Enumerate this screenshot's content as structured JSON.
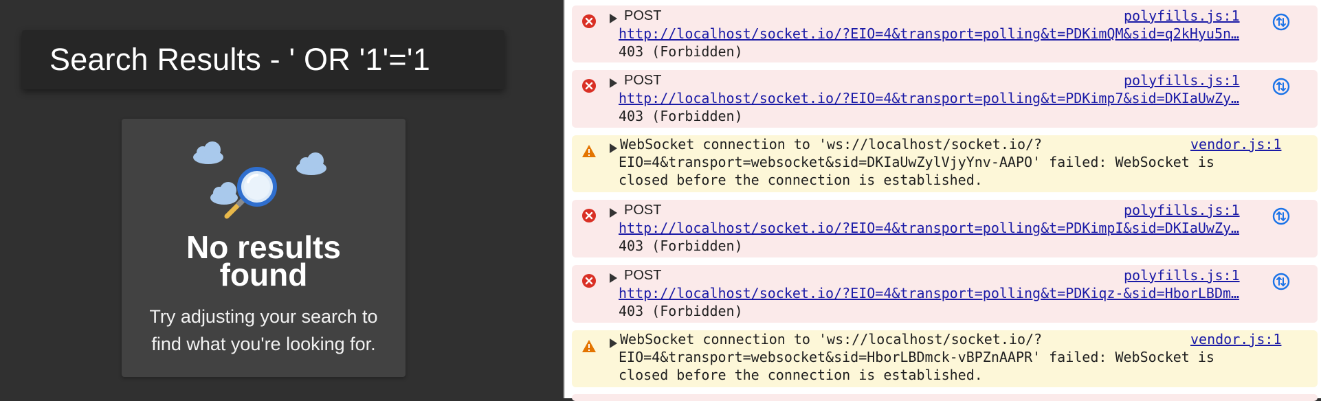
{
  "app": {
    "search_title": "Search Results - ' OR '1'='1",
    "empty_state": {
      "heading_line1": "No results",
      "heading_line2": "found",
      "hint_line1": "Try adjusting your search to",
      "hint_line2": "find what you're looking for."
    }
  },
  "console": {
    "entries": [
      {
        "level": "error",
        "method": "POST",
        "source": "polyfills.js:1",
        "url": "http://localhost/socket.io/?EIO=4&transport=polling&t=PDKimQM&sid=q2kHyu5n…",
        "status": "403 (Forbidden)"
      },
      {
        "level": "error",
        "method": "POST",
        "source": "polyfills.js:1",
        "url": "http://localhost/socket.io/?EIO=4&transport=polling&t=PDKimp7&sid=DKIaUwZy…",
        "status": "403 (Forbidden)"
      },
      {
        "level": "warning",
        "source": "vendor.js:1",
        "line1": "WebSocket connection to 'ws://localhost/socket.io/?",
        "line2": "EIO=4&transport=websocket&sid=DKIaUwZylVjyYnv-AAPO' failed: WebSocket is",
        "line3": "closed before the connection is established."
      },
      {
        "level": "error",
        "method": "POST",
        "source": "polyfills.js:1",
        "url": "http://localhost/socket.io/?EIO=4&transport=polling&t=PDKimpI&sid=DKIaUwZy…",
        "status": "403 (Forbidden)"
      },
      {
        "level": "error",
        "method": "POST",
        "source": "polyfills.js:1",
        "url": "http://localhost/socket.io/?EIO=4&transport=polling&t=PDKiqz-&sid=HborLBDm…",
        "status": "403 (Forbidden)"
      },
      {
        "level": "warning",
        "source": "vendor.js:1",
        "line1": "WebSocket connection to 'ws://localhost/socket.io/?",
        "line2": "EIO=4&transport=websocket&sid=HborLBDmck-vBPZnAAPR' failed: WebSocket is",
        "line3": "closed before the connection is established."
      }
    ]
  },
  "colors": {
    "error_bg": "#fbeaea",
    "warning_bg": "#fdf7d8",
    "error_icon": "#d93025",
    "warning_icon": "#e37400",
    "link": "#1a1aa6"
  },
  "icons": [
    "error-icon",
    "warning-icon",
    "expand-triangle-icon",
    "network-request-icon",
    "cloud-icon",
    "magnifier-icon"
  ]
}
